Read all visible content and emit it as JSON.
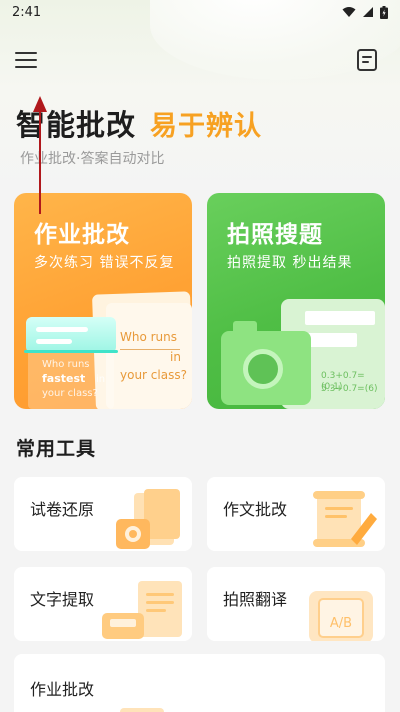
{
  "status_bar": {
    "time": "2:41"
  },
  "header": {
    "title": "智能批改",
    "slogan": "易于辨认",
    "subtitle": "作业批改·答案自动对比"
  },
  "feature_cards": [
    {
      "title": "作业批改",
      "desc": "多次练习 错误不反复",
      "art_text": {
        "front_line1": "Who runs",
        "front_line2": "in",
        "front_line3": "your class?",
        "back_line1": "Who runs",
        "back_line2": "fastest",
        "back_line3": "in",
        "back_line4": "your class?"
      },
      "color": "#ffa234"
    },
    {
      "title": "拍照搜题",
      "desc": "拍照提取 秒出结果",
      "art_text": {
        "calc1": "0.3+0.7=(0.1)",
        "calc2": "5.3+0.7=(6)"
      },
      "color": "#4fbe45"
    }
  ],
  "tools": {
    "section_title": "常用工具",
    "items": [
      {
        "label": "试卷还原",
        "icon": "exam-restore-icon"
      },
      {
        "label": "作文批改",
        "icon": "essay-scroll-icon"
      },
      {
        "label": "文字提取",
        "icon": "text-extract-icon"
      },
      {
        "label": "拍照翻译",
        "icon": "translate-icon",
        "art_text": "A/B"
      },
      {
        "label": "作业批改"
      }
    ]
  },
  "accent_colors": {
    "orange": "#f7a122",
    "green": "#4fbe45"
  }
}
